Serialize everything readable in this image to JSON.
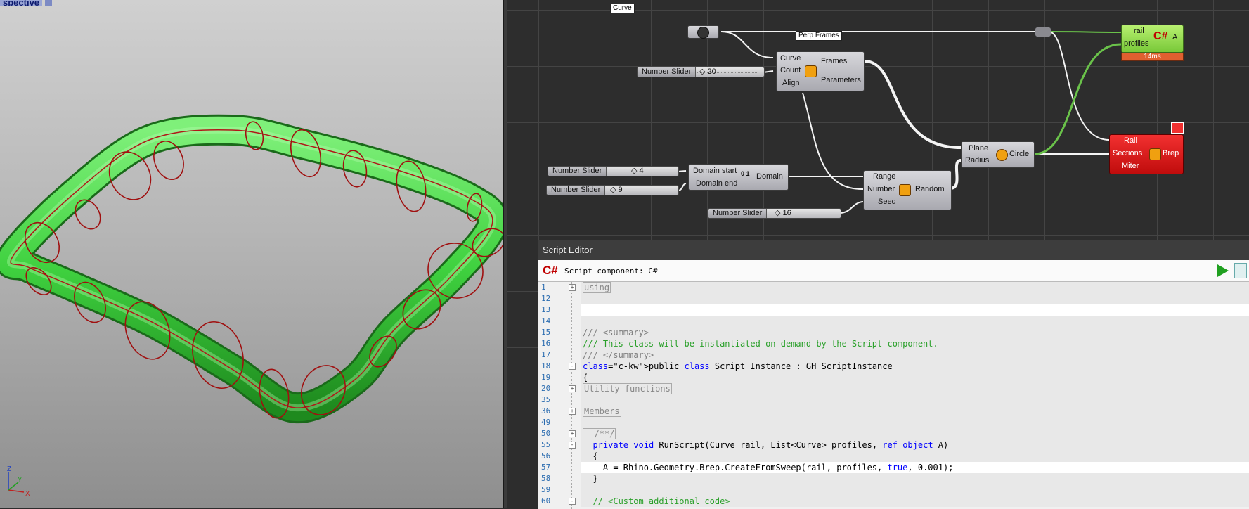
{
  "viewport": {
    "label": "spective",
    "axes": {
      "z": "Z",
      "y": "y",
      "x": "X"
    }
  },
  "canvas": {
    "curve_param": {
      "tag": "Curve"
    },
    "perp_frames": {
      "tag": "Perp Frames",
      "inputs": [
        "Curve",
        "Count",
        "Align"
      ],
      "outputs": [
        "Frames",
        "Parameters"
      ]
    },
    "sliders": [
      {
        "name": "Number Slider",
        "value": "20"
      },
      {
        "name": "Number Slider",
        "value": "4"
      },
      {
        "name": "Number Slider",
        "value": "9"
      },
      {
        "name": "Number Slider",
        "value": "16"
      }
    ],
    "construct_domain": {
      "inputs": [
        "Domain start",
        "Domain end"
      ],
      "output": "Domain",
      "icon_text": "0 1"
    },
    "random": {
      "inputs": [
        "Range",
        "Number",
        "Seed"
      ],
      "output": "Random"
    },
    "circle": {
      "inputs": [
        "Plane",
        "Radius"
      ],
      "output": "Circle"
    },
    "script_comp": {
      "inputs": [
        "rail",
        "profiles"
      ],
      "output": "A",
      "timing": "14ms",
      "icon": "C#"
    },
    "sweep": {
      "inputs": [
        "Rail",
        "Sections",
        "Miter"
      ],
      "output": "Brep"
    }
  },
  "editor": {
    "title": "Script Editor",
    "subtitle": "Script component: C#",
    "icon": "C#",
    "lines": [
      {
        "n": "1",
        "fold": "+",
        "text": "using",
        "style": "box",
        "bg": "shade"
      },
      {
        "n": "12",
        "fold": "",
        "text": "",
        "style": "",
        "bg": "shade"
      },
      {
        "n": "13",
        "fold": "",
        "text": "",
        "style": "",
        "bg": "white"
      },
      {
        "n": "14",
        "fold": "",
        "text": "",
        "style": "",
        "bg": "shade"
      },
      {
        "n": "15",
        "fold": "",
        "text": "/// <summary>",
        "style": "gray",
        "bg": "shade"
      },
      {
        "n": "16",
        "fold": "",
        "text": "/// This class will be instantiated on demand by the Script component.",
        "style": "com",
        "bg": "shade"
      },
      {
        "n": "17",
        "fold": "",
        "text": "/// </summary>",
        "style": "gray",
        "bg": "shade"
      },
      {
        "n": "18",
        "fold": "-",
        "text": "public class Script_Instance : GH_ScriptInstance",
        "style": "class",
        "bg": "shade"
      },
      {
        "n": "19",
        "fold": "",
        "text": "{",
        "style": "",
        "bg": "shade"
      },
      {
        "n": "20",
        "fold": "+",
        "text": "Utility functions",
        "style": "box",
        "bg": "shade"
      },
      {
        "n": "35",
        "fold": "",
        "text": "",
        "style": "",
        "bg": "shade"
      },
      {
        "n": "36",
        "fold": "+",
        "text": "Members",
        "style": "box",
        "bg": "shade"
      },
      {
        "n": "49",
        "fold": "",
        "text": "",
        "style": "",
        "bg": "shade"
      },
      {
        "n": "50",
        "fold": "+",
        "text": "  /**/",
        "style": "box",
        "bg": "shade"
      },
      {
        "n": "55",
        "fold": "-",
        "text": "  private void RunScript(Curve rail, List<Curve> profiles, ref object A)",
        "style": "method",
        "bg": "shade"
      },
      {
        "n": "56",
        "fold": "",
        "text": "  {",
        "style": "",
        "bg": "shade"
      },
      {
        "n": "57",
        "fold": "",
        "text": "    A = Rhino.Geometry.Brep.CreateFromSweep(rail, profiles, true, 0.001);",
        "style": "call",
        "bg": "white"
      },
      {
        "n": "58",
        "fold": "",
        "text": "  }",
        "style": "",
        "bg": "shade"
      },
      {
        "n": "59",
        "fold": "",
        "text": "",
        "style": "",
        "bg": "shade"
      },
      {
        "n": "60",
        "fold": "-",
        "text": "  // <Custom additional code>",
        "style": "com",
        "bg": "shade"
      }
    ]
  },
  "colors": {
    "sweep_green": "#3fd13f",
    "section_red": "#a01010",
    "script_green": "#8fe04a",
    "sweep_error": "#e01414"
  }
}
